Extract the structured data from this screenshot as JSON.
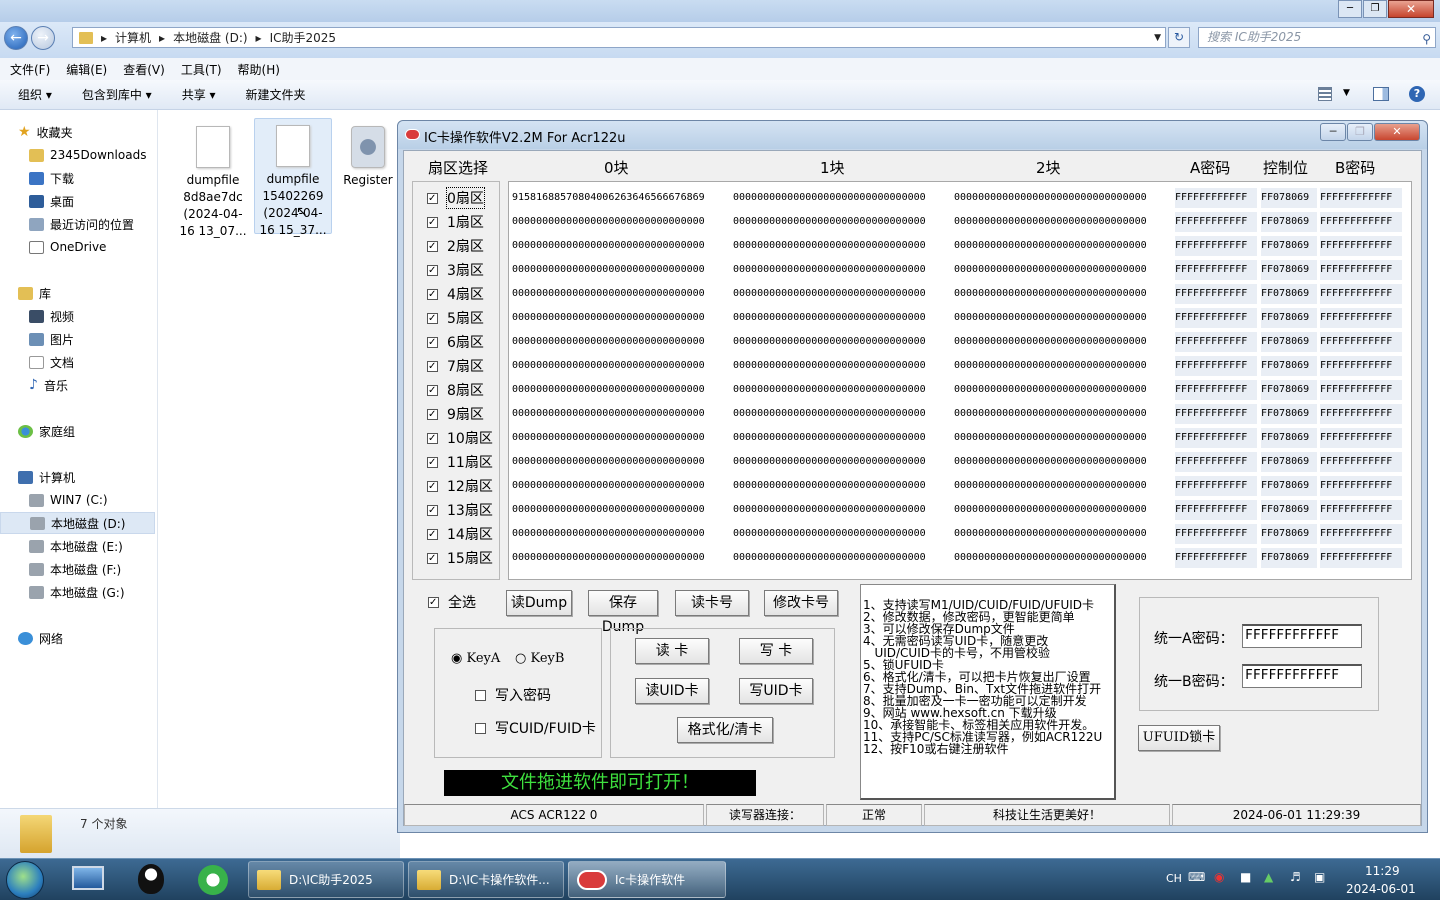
{
  "explorer": {
    "breadcrumb": [
      "计算机",
      "本地磁盘 (D:)",
      "IC助手2025"
    ],
    "search_placeholder": "搜索 IC助手2025",
    "menu": [
      "文件(F)",
      "编辑(E)",
      "查看(V)",
      "工具(T)",
      "帮助(H)"
    ],
    "toolbar": [
      "组织 ▾",
      "包含到库中 ▾",
      "共享 ▾",
      "新建文件夹"
    ],
    "nav": {
      "favorites": "收藏夹",
      "fav_items": [
        "2345Downloads",
        "下载",
        "桌面",
        "最近访问的位置",
        "OneDrive"
      ],
      "libraries": "库",
      "lib_items": [
        "视频",
        "图片",
        "文档",
        "音乐"
      ],
      "homegroup": "家庭组",
      "computer": "计算机",
      "drives": [
        "WIN7 (C:)",
        "本地磁盘 (D:)",
        "本地磁盘 (E:)",
        "本地磁盘 (F:)",
        "本地磁盘 (G:)"
      ],
      "network": "网络"
    },
    "files": [
      {
        "l1": "dumpfile",
        "l2": "8d8ae7dc",
        "l3": "(2024-04-",
        "l4": "16 13_07..."
      },
      {
        "l1": "dumpfile",
        "l2": "15402269",
        "l3": "(2024-04-",
        "l4": "16 15_37..."
      },
      {
        "l1": "Register"
      }
    ],
    "status_count": "7 个对象"
  },
  "ic": {
    "title": "IC卡操作软件V2.2M For Acr122u",
    "headers": {
      "sector": "扇区选择",
      "b0": "0块",
      "b1": "1块",
      "b2": "2块",
      "keya": "A密码",
      "ctrl": "控制位",
      "keyb": "B密码"
    },
    "sectors": [
      "0扇区",
      "1扇区",
      "2扇区",
      "3扇区",
      "4扇区",
      "5扇区",
      "6扇区",
      "7扇区",
      "8扇区",
      "9扇区",
      "10扇区",
      "11扇区",
      "12扇区",
      "13扇区",
      "14扇区",
      "15扇区"
    ],
    "block0_first": "91581688570804006263646566676869",
    "block_zero": "00000000000000000000000000000000",
    "keya": "FFFFFFFFFFFF",
    "ctrl": "FF078069",
    "keyb": "FFFFFFFFFFFF",
    "select_all": "全选",
    "btn": {
      "read_dump": "读Dump",
      "save_dump": "保存Dump",
      "read_no": "读卡号",
      "mod_no": "修改卡号",
      "read": "读  卡",
      "write": "写  卡",
      "read_uid": "读UID卡",
      "write_uid": "写UID卡",
      "format": "格式化/清卡",
      "ufuid_lock": "UFUID锁卡"
    },
    "keya_radio": "KeyA",
    "keyb_radio": "KeyB",
    "write_pwd": "写入密码",
    "write_cuid": "写CUID/FUID卡",
    "info": "1、支持读写M1/UID/CUID/FUID/UFUID卡\n2、修改数据，修改密码，更智能更简单\n3、可以修改保存Dump文件\n4、无需密码读写UID卡，随意更改\n   UID/CUID卡的卡号，不用管校验\n5、锁UFUID卡\n6、格式化/清卡，可以把卡片恢复出厂设置\n7、支持Dump、Bin、Txt文件拖进软件打开\n8、批量加密及一卡一密功能可以定制开发\n9、网站 www.hexsoft.cn 下载升级\n10、承接智能卡、标签相关应用软件开发。\n11、支持PC/SC标准读写器，例如ACR122U\n12、按F10或右键注册软件",
    "unified_a_label": "统一A密码：",
    "unified_b_label": "统一B密码：",
    "unified_a": "FFFFFFFFFFFF",
    "unified_b": "FFFFFFFFFFFF",
    "drop_banner": "文件拖进软件即可打开！",
    "status": {
      "reader": "ACS ACR122 0",
      "conn_label": "读写器连接：",
      "conn": "正常",
      "slogan": "科技让生活更美好！",
      "datetime": "2024-06-01 11:29:39"
    }
  },
  "taskbar": {
    "items": [
      "D:\\IC助手2025",
      "D:\\IC卡操作软件...",
      "Ic卡操作软件"
    ],
    "ime": "CH",
    "time": "11:29",
    "date": "2024-06-01"
  },
  "colors": {
    "banner_text": "#3ee03e",
    "taskbar": "#2a5276",
    "selection": "#dde8f5"
  }
}
